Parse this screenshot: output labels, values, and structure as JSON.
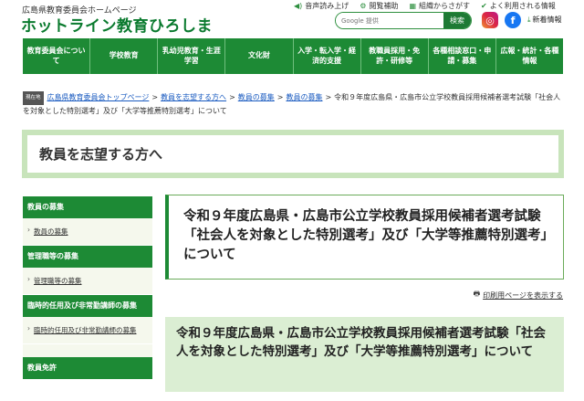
{
  "header": {
    "sub": "広島県教育委員会ホームページ",
    "title": "ホットライン教育ひろしま",
    "util": [
      "音声読み上げ",
      "閲覧補助",
      "組織からさがす",
      "よく利用される情報"
    ],
    "search_placeholder": "Google 提供",
    "search_button": "検索",
    "new_arrivals": "新着情報"
  },
  "nav": [
    "教育委員会について",
    "学校教育",
    "乳幼児教育・生涯学習",
    "文化財",
    "入学・転入学・経済的支援",
    "教職員採用・免許・研修等",
    "各種相談窓口・申請・募集",
    "広報・統計・各種情報"
  ],
  "breadcrumb": {
    "here": "現在地",
    "links": [
      "広島県教育委員会トップページ",
      "教員を志望する方へ",
      "教員の募集",
      "教員の募集"
    ],
    "current": "令和９年度広島県・広島市公立学校教員採用候補者選考試験「社会人を対象とした特別選考」及び「大学等推薦特別選考」について"
  },
  "section_title": "教員を志望する方へ",
  "sidebar": {
    "sections": [
      {
        "heading": "教員の募集",
        "link": "教員の募集"
      },
      {
        "heading": "管理職等の募集",
        "link": "管理職等の募集"
      },
      {
        "heading": "臨時的任用及び非常勤講師の募集",
        "link": "臨時的任用及び非常勤講師の募集"
      },
      {
        "heading": "教員免許",
        "link": ""
      }
    ]
  },
  "main": {
    "page_title": "令和９年度広島県・広島市公立学校教員採用候補者選考試験「社会人を対象とした特別選考」及び「大学等推薦特別選考」について",
    "print_label": "印刷用ページを表示する",
    "heading2": "令和９年度広島県・広島市公立学校教員採用候補者選考試験「社会人を対象とした特別選考」及び「大学等推薦特別選考」について"
  }
}
